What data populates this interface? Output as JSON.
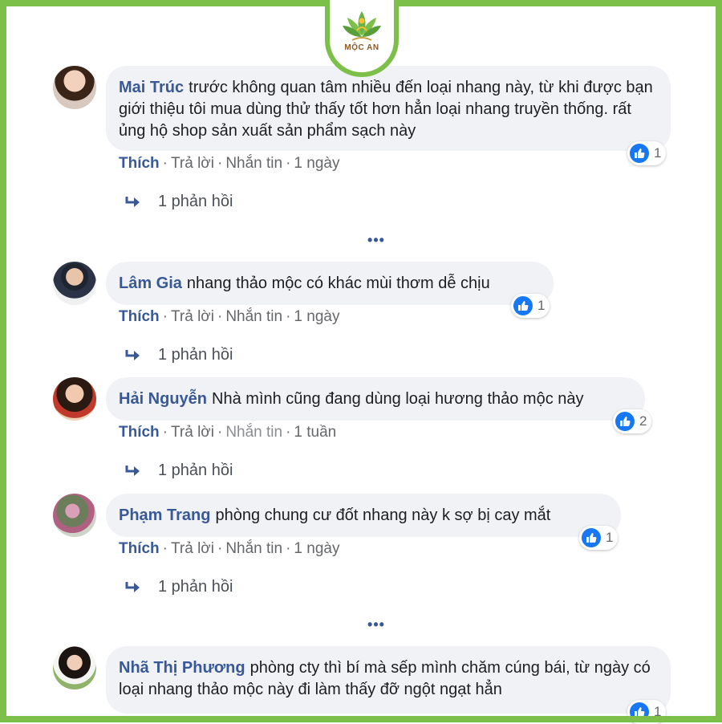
{
  "brand": {
    "logo_text": "MỘC AN",
    "colors": {
      "frame": "#7cc04a",
      "name": "#385898",
      "bubble": "#f0f2f5",
      "like": "#1877f2"
    }
  },
  "actions": {
    "like": "Thích",
    "reply": "Trả lời",
    "message": "Nhắn tin",
    "dot": "·"
  },
  "more_label": "•••",
  "comments": [
    {
      "name": "Mai Trúc",
      "text": "trước không quan tâm nhiều đến loại nhang này, từ khi được bạn giới thiệu tôi mua dùng thử thấy tốt hơn hẳn loại nhang truyền thống. rất ủng hộ shop sản xuất sản phẩm sạch này",
      "likes": "1",
      "time": "1 ngày",
      "replies": "1 phản hồi",
      "avatar": "person-avatar"
    },
    {
      "name": "Lâm Gia",
      "text": "nhang thảo mộc có khác mùi thơm dễ chịu",
      "likes": "1",
      "time": "1 ngày",
      "replies": "1 phản hồi",
      "avatar": "person-avatar"
    },
    {
      "name": "Hải Nguyễn",
      "text": "Nhà mình cũng đang dùng loại hương thảo mộc này",
      "likes": "2",
      "time": "1 tuần",
      "replies": "1 phản hồi",
      "avatar": "person-avatar"
    },
    {
      "name": "Phạm Trang",
      "text": "phòng chung cư đốt nhang này k sợ bị cay mắt",
      "likes": "1",
      "time": "1 ngày",
      "replies": "1 phản hồi",
      "avatar": "person-avatar"
    },
    {
      "name": "Nhã Thị Phương",
      "text": "phòng cty thì bí mà sếp mình chăm cúng bái, từ ngày có loại nhang thảo mộc này đi làm thấy đỡ ngột ngạt hẳn",
      "likes": "1",
      "avatar": "person-avatar"
    }
  ]
}
